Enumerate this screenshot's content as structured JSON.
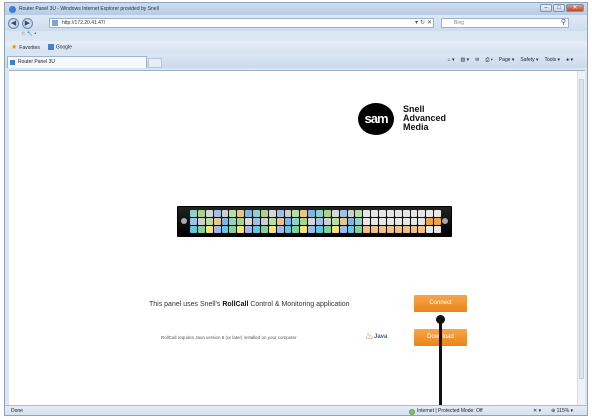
{
  "browser": {
    "title": "Router Panel 3U - Windows Internet Explorer provided by Snell",
    "address": "http://172.20.41.47/",
    "search_placeholder": "Bing",
    "command_text": "☆ 🔧 •",
    "favorites_label": "Favorites",
    "google_label": "Google",
    "tab_title": "Router Panel 3U",
    "toolbar": {
      "page": "Page ▾",
      "safety": "Safety ▾",
      "tools": "Tools ▾",
      "help": "● ▾"
    },
    "window_buttons": {
      "min": "–",
      "max": "□",
      "close": "✕"
    }
  },
  "page": {
    "logo_mark": "sam",
    "logo_lines": [
      "Snell",
      "Advanced",
      "Media"
    ],
    "panel_text_prefix": "This panel uses Snell's",
    "panel_text_brand": "RollCall",
    "panel_text_suffix": "Control & Monitoring application",
    "note": "RollCall requires Java version 8 (or later) installed on your computer",
    "java_label": "Java",
    "connect_label": "Connect",
    "download_label": "Download",
    "colors": {
      "accent": "#ee8a22",
      "panel": "#111111"
    }
  },
  "status": {
    "left": "Done",
    "zone": "Internet | Protected Mode: Off",
    "zoom": "⊕ 115% ▾",
    "security": "✕ ▾"
  }
}
